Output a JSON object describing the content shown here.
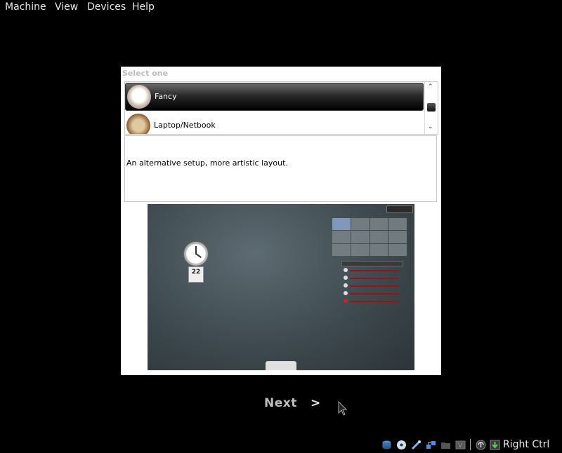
{
  "menu": [
    "Machine",
    "View",
    "Devices",
    "Help"
  ],
  "dialog": {
    "title": "Select one",
    "items": [
      {
        "label": "Fancy",
        "icon": "fancy-theme-icon",
        "selected": true
      },
      {
        "label": "Laptop/Netbook",
        "icon": "laptop-theme-icon",
        "selected": false
      }
    ],
    "description": "An alternative setup, more artistic layout.",
    "preview": {
      "calendar_day": "22"
    }
  },
  "next_label": "Next",
  "next_arrow": ">",
  "status_bar": {
    "icons": [
      "hard-disk-icon",
      "optical-disk-icon",
      "usb-icon",
      "network-icon",
      "shared-folder-icon",
      "display-icon",
      "mouse-integration-icon",
      "keyboard-capture-icon"
    ],
    "host_key": "Right Ctrl"
  }
}
